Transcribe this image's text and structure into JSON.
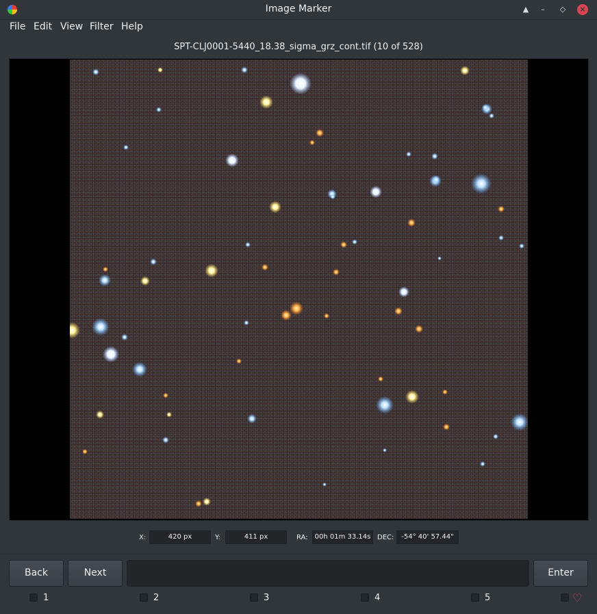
{
  "window": {
    "title": "Image Marker",
    "close_glyph": "×"
  },
  "menu": [
    "File",
    "Edit",
    "View",
    "Filter",
    "Help"
  ],
  "image": {
    "filename_caption": "SPT-CLJ0001-5440_18.38_sigma_grz_cont.tif (10 of 528)"
  },
  "coordinates": {
    "x_label": "X:",
    "x_value": "420 px",
    "y_label": "Y:",
    "y_value": "411 px",
    "ra_label": "RA:",
    "ra_value": "00h 01m 33.14s",
    "dec_label": "DEC:",
    "dec_value": "-54° 40' 57.44\""
  },
  "buttons": {
    "back": "Back",
    "next": "Next",
    "enter": "Enter"
  },
  "comment_box": {
    "value": ""
  },
  "categories": [
    "1",
    "2",
    "3",
    "4",
    "5"
  ],
  "favorite_icon": "heart-icon",
  "colors": {
    "background": "#31363b",
    "close_button": "#da4453",
    "heart": "#da4453"
  }
}
